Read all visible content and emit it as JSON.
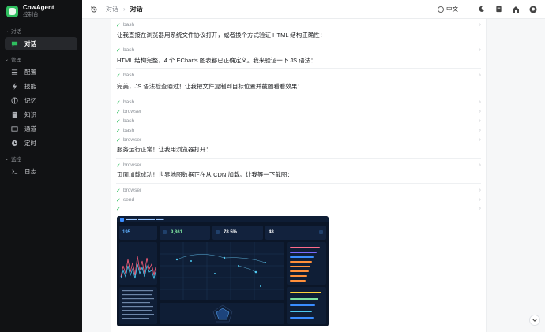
{
  "app": {
    "name": "CowAgent",
    "subtitle": "控制台"
  },
  "sidebar": {
    "sections": [
      {
        "label": "对话",
        "items": [
          {
            "label": "对话",
            "icon": "chat-icon",
            "active": true
          }
        ]
      },
      {
        "label": "管理",
        "items": [
          {
            "label": "配置",
            "icon": "sliders-icon"
          },
          {
            "label": "技能",
            "icon": "lightning-icon"
          },
          {
            "label": "记忆",
            "icon": "brain-icon"
          },
          {
            "label": "知识",
            "icon": "book-icon"
          },
          {
            "label": "通道",
            "icon": "channel-icon"
          },
          {
            "label": "定时",
            "icon": "clock-icon"
          }
        ]
      },
      {
        "label": "监控",
        "items": [
          {
            "label": "日志",
            "icon": "terminal-icon"
          }
        ]
      }
    ]
  },
  "topbar": {
    "breadcrumb": [
      "对话",
      "对话"
    ],
    "language": "中文"
  },
  "chat": {
    "tools": [
      "bash",
      "bash",
      "bash",
      "bash",
      "browser",
      "bash",
      "bash",
      "browser",
      "browser",
      "browser",
      "send"
    ],
    "messages": [
      "让我直接在浏览器用系统文件协议打开，或者换个方式验证 HTML 结构正确性：",
      "HTML 结构完整，4 个 ECharts 图表都已正确定义。我来验证一下 JS 语法：",
      "完美，JS 语法检查通过！让我把文件复制到目标位置并截图看看效果：",
      "服务运行正常！让我用浏览器打开：",
      "页面加载成功！世界地图数据正在从 CDN 加载。让我等一下截图："
    ]
  },
  "screenshot": {
    "kpis": [
      {
        "value": "195",
        "color": "#5fb0ff"
      },
      {
        "value": "9,861",
        "color": "#7de3a0"
      },
      {
        "value": "78.5%",
        "color": "#ffffff"
      },
      {
        "value": "48.",
        "color": "#ffffff"
      }
    ]
  },
  "colors": {
    "accent": "#2fbf5f",
    "sidebar": "#111214"
  }
}
